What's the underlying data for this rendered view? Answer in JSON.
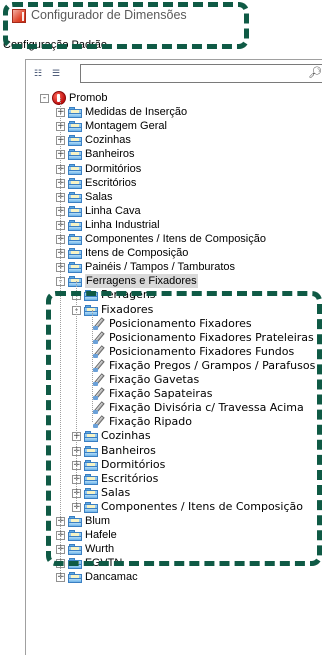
{
  "window": {
    "title": "Configurador de Dimensões",
    "subtitle": "Configuração Padrão"
  },
  "toolbar": {
    "find_icon": "binoculars-icon",
    "expand_icon": "expand-tree-icon",
    "collapse_icon": "collapse-tree-icon",
    "search_value": ""
  },
  "tree": {
    "root": "Promob",
    "level1_top": [
      "Medidas de Inserção",
      "Montagem Geral",
      "Cozinhas",
      "Banheiros",
      "Dormitórios",
      "Escritórios",
      "Salas",
      "Linha Cava",
      "Linha Industrial",
      "Componentes / Itens de Composição",
      "Itens de Composição",
      "Painéis / Tampos / Tamburatos"
    ],
    "expanded_group": "Ferragens e Fixadores",
    "ferragens": "Ferragens",
    "fixadores": "Fixadores",
    "fixadores_items": [
      "Posicionamento Fixadores",
      "Posicionamento Fixadores Prateleiras",
      "Posicionamento Fixadores Fundos",
      "Fixação Pregos / Grampos / Parafusos",
      "Fixação Gavetas",
      "Fixação Sapateiras",
      "Fixação Divisória c/ Travessa Acima",
      "Fixação Ripado"
    ],
    "sub_folders": [
      "Cozinhas",
      "Banheiros",
      "Dormitórios",
      "Escritórios",
      "Salas",
      "Componentes / Itens de Composição"
    ],
    "level1_bottom": [
      "Blum",
      "Hafele",
      "Wurth",
      "FGVTN",
      "Dancamac"
    ]
  },
  "colors": {
    "callout": "#0f5a45",
    "folder": "#5ea9e4",
    "selected": "#d9d9d9"
  }
}
